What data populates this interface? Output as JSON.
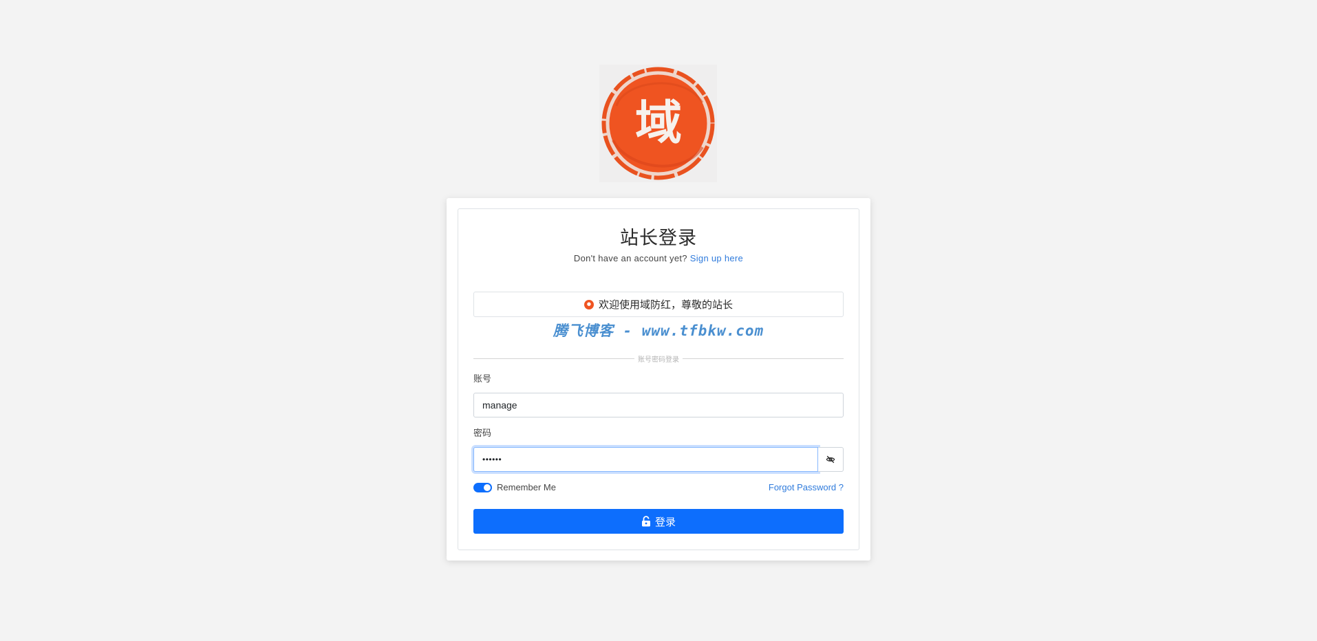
{
  "logo": {
    "glyph": "域",
    "background_color": "#ef5421"
  },
  "login": {
    "title": "站长登录",
    "signup_prompt": "Don't have an account yet?",
    "signup_link": "Sign up here",
    "welcome_button": "欢迎使用域防红，尊敬的站长",
    "watermark": "腾飞博客 - www.tfbkw.com",
    "divider_text": "账号密码登录",
    "account_label": "账号",
    "account_value": "manage",
    "password_label": "密码",
    "password_value": "••••••",
    "remember_label": "Remember Me",
    "remember_checked": true,
    "forgot_link": "Forgot Password ?",
    "submit_label": "登录"
  },
  "icons": {
    "eye_toggle": "eye-slash-icon",
    "submit": "unlock-icon"
  },
  "colors": {
    "primary": "#0d6efd",
    "link": "#2f7bdc",
    "page_background": "#f3f3f3",
    "watermark": "#4a8fd0"
  }
}
